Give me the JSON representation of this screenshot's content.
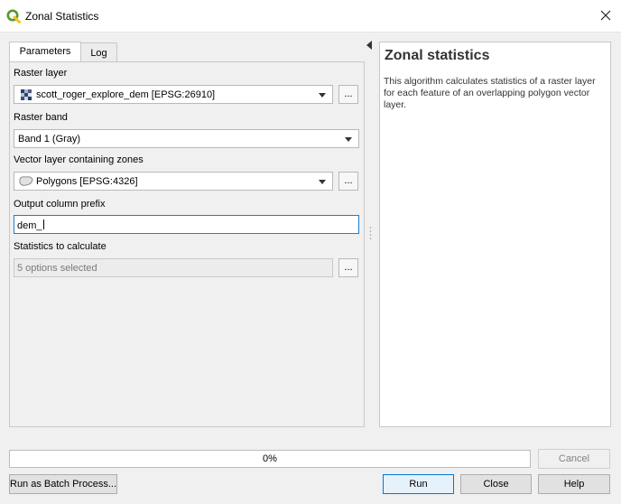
{
  "window": {
    "title": "Zonal Statistics"
  },
  "tabs": [
    {
      "label": "Parameters",
      "active": true
    },
    {
      "label": "Log",
      "active": false
    }
  ],
  "params": {
    "raster_layer": {
      "label": "Raster layer",
      "value": "scott_roger_explore_dem [EPSG:26910]",
      "icon": "raster-layer-icon"
    },
    "raster_band": {
      "label": "Raster band",
      "value": "Band 1 (Gray)"
    },
    "vector_layer": {
      "label": "Vector layer containing zones",
      "value": "Polygons [EPSG:4326]",
      "icon": "polygon-layer-icon"
    },
    "prefix": {
      "label": "Output column prefix",
      "value": "dem_"
    },
    "statistics": {
      "label": "Statistics to calculate",
      "value": "5 options selected"
    },
    "browse_label": "..."
  },
  "help": {
    "title": "Zonal statistics",
    "body": "This algorithm calculates statistics of a raster layer for each feature of an overlapping polygon vector layer."
  },
  "progress": {
    "value": 0,
    "text": "0%"
  },
  "buttons": {
    "cancel": "Cancel",
    "batch": "Run as Batch Process...",
    "run": "Run",
    "close": "Close",
    "help": "Help"
  },
  "colors": {
    "qgis_green": "#589632",
    "qgis_yellow": "#f0c419",
    "focus_blue": "#1a7fd0"
  }
}
